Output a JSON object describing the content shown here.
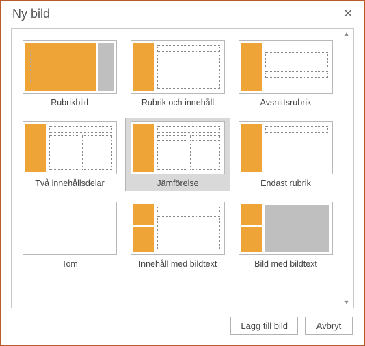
{
  "dialog": {
    "title": "Ny bild",
    "close_label": "✕"
  },
  "layouts": [
    {
      "label": "Rubrikbild",
      "selected": false,
      "kind": "title"
    },
    {
      "label": "Rubrik och innehåll",
      "selected": false,
      "kind": "title_content"
    },
    {
      "label": "Avsnittsrubrik",
      "selected": false,
      "kind": "section"
    },
    {
      "label": "Två innehållsdelar",
      "selected": false,
      "kind": "two_content"
    },
    {
      "label": "Jämförelse",
      "selected": true,
      "kind": "comparison"
    },
    {
      "label": "Endast rubrik",
      "selected": false,
      "kind": "title_only"
    },
    {
      "label": "Tom",
      "selected": false,
      "kind": "blank"
    },
    {
      "label": "Innehåll med bildtext",
      "selected": false,
      "kind": "content_caption"
    },
    {
      "label": "Bild med bildtext",
      "selected": false,
      "kind": "picture_caption"
    }
  ],
  "buttons": {
    "add": "Lägg till bild",
    "cancel": "Avbryt"
  },
  "scroll": {
    "up": "▴",
    "down": "▾"
  },
  "colors": {
    "accent": "#eea437",
    "dialog_border": "#b85a2a"
  }
}
